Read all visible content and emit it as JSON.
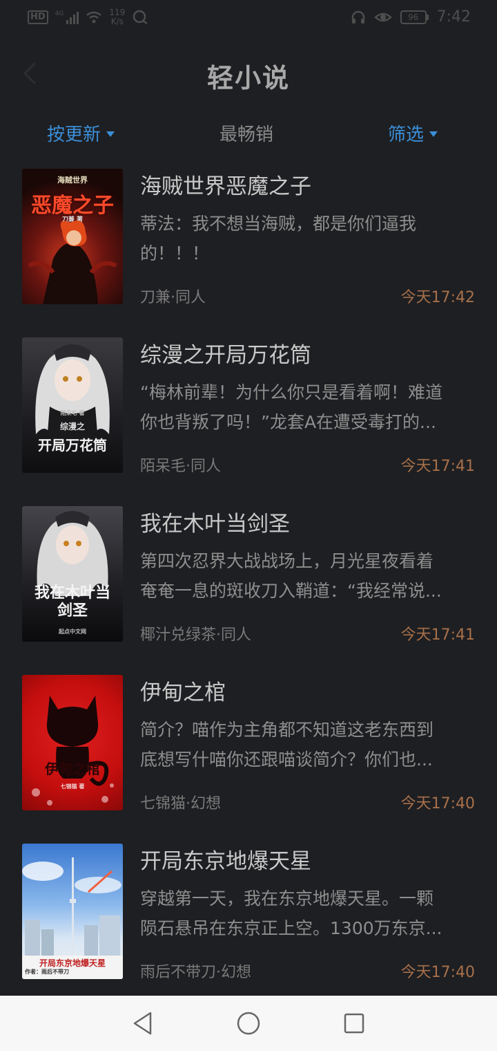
{
  "status_bar": {
    "network": "HD",
    "net_gen": "4G",
    "speed_value": "119",
    "speed_unit": "K/s",
    "battery": "96",
    "time": "7:42"
  },
  "header": {
    "title": "轻小说"
  },
  "sort_bar": {
    "tab_latest": "按更新",
    "tab_bestselling": "最畅销",
    "tab_filter": "筛选"
  },
  "books": [
    {
      "title": "海贼世界恶魔之子",
      "desc_line1": "蒂法：我不想当海贼，都是你们逼我",
      "desc_line2": "的！！！",
      "meta": "刀兼·同人",
      "time": "今天17:42",
      "cover_text_top": "海贼世界",
      "cover_text_main": "恶魔之子",
      "cover_author": "刀兼 著"
    },
    {
      "title": "综漫之开局万花筒",
      "desc_line1": "“梅林前辈！为什么你只是看着啊！难道",
      "desc_line2": "你也背叛了吗！”龙套A在遭受毒打的...",
      "meta": "陌呆毛·同人",
      "time": "今天17:41",
      "cover_text_top": "综漫之",
      "cover_text_main": "开局万花筒",
      "cover_author": "陌呆毛 著"
    },
    {
      "title": "我在木叶当剑圣",
      "desc_line1": "第四次忍界大战战场上，月光星夜看着",
      "desc_line2": "奄奄一息的斑收刀入鞘道：“我经常说...",
      "meta": "椰汁兑绿茶·同人",
      "time": "今天17:41",
      "cover_text_top": "",
      "cover_text_main": "我在木叶当剑圣",
      "cover_author": "起点中文网"
    },
    {
      "title": "伊甸之棺",
      "desc_line1": "简介？喵作为主角都不知道这老东西到",
      "desc_line2": "底想写什喵你还跟喵谈简介？你们也...",
      "meta": "七锦猫·幻想",
      "time": "今天17:40",
      "cover_text_top": "",
      "cover_text_main": "伊甸之棺",
      "cover_author": "七锦猫 著"
    },
    {
      "title": "开局东京地爆天星",
      "desc_line1": "穿越第一天，我在东京地爆天星。一颗",
      "desc_line2": "陨石悬吊在东京正上空。1300万东京...",
      "meta": "雨后不带刀·幻想",
      "time": "今天17:40",
      "cover_text_top": "",
      "cover_text_main": "开局东京地爆天星",
      "cover_author": "作者：雨后不带刀"
    }
  ],
  "colors": {
    "background": "#1e1f22",
    "accent": "#3b8fd9",
    "time": "#a8704a"
  }
}
